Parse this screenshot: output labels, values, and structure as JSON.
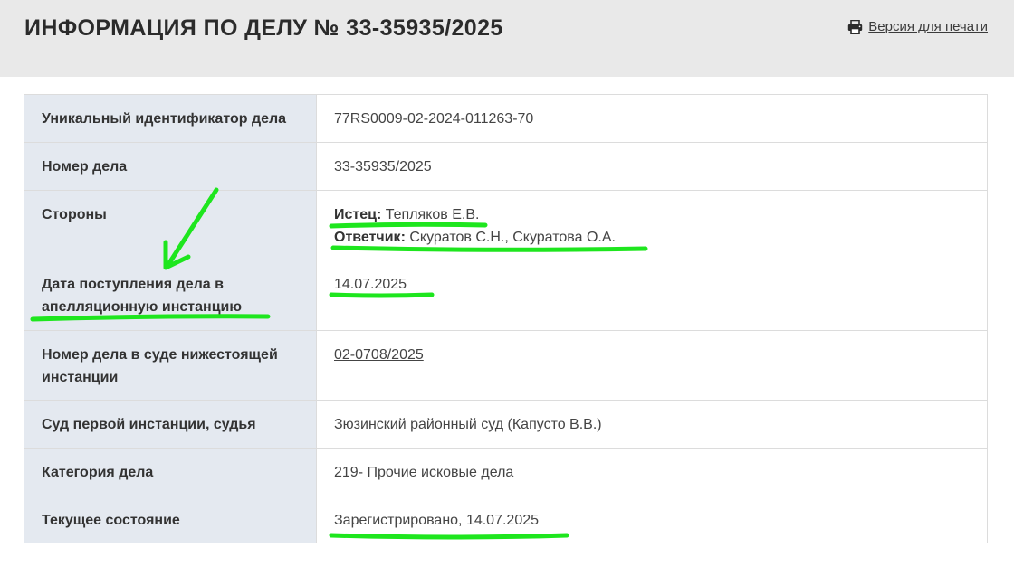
{
  "header": {
    "title": "ИНФОРМАЦИЯ ПО ДЕЛУ № 33-35935/2025",
    "print_label": "Версия для печати"
  },
  "rows": [
    {
      "label": "Уникальный идентификатор дела",
      "value": "77RS0009-02-2024-011263-70"
    },
    {
      "label": "Номер дела",
      "value": "33-35935/2025"
    },
    {
      "label": "Стороны",
      "plaintiff_label": "Истец:",
      "plaintiff_value": "Тепляков Е.В.",
      "defendant_label": "Ответчик:",
      "defendant_value": "Скуратов С.Н., Скуратова О.А."
    },
    {
      "label": "Дата поступления дела в апелляционную инстанцию",
      "value": "14.07.2025"
    },
    {
      "label": "Номер дела в суде нижестоящей инстанции",
      "value": "02-0708/2025"
    },
    {
      "label": "Суд первой инстанции, судья",
      "value": "Зюзинский районный суд (Капусто В.В.)"
    },
    {
      "label": "Категория дела",
      "value": "219- Прочие исковые дела"
    },
    {
      "label": "Текущее состояние",
      "value": "Зарегистрировано, 14.07.2025"
    }
  ],
  "icons": {
    "print": "printer-icon"
  },
  "colors": {
    "header_bg": "#e9e9e9",
    "label_bg": "#e4e9f0",
    "highlight": "#1ee61e"
  }
}
